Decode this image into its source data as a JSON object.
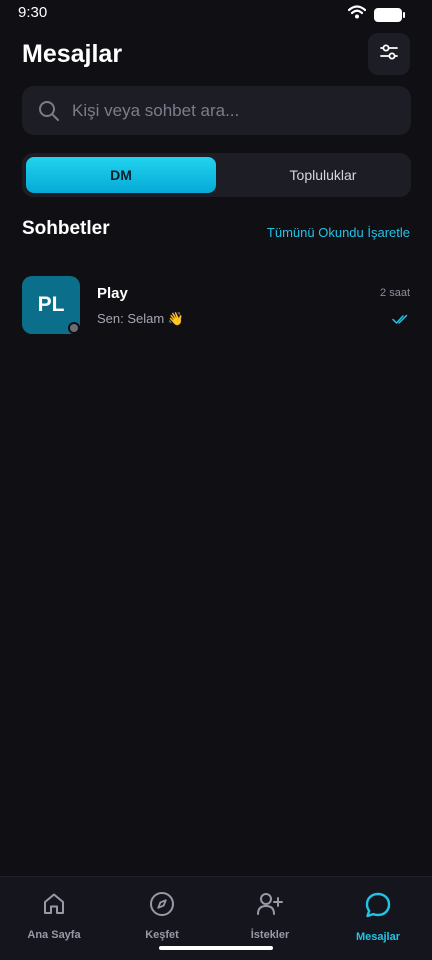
{
  "status_bar": {
    "time": "9:30"
  },
  "header": {
    "title": "Mesajlar"
  },
  "search": {
    "placeholder": "Kişi veya sohbet ara..."
  },
  "tabs": [
    {
      "label": "DM",
      "active": true
    },
    {
      "label": "Topluluklar",
      "active": false
    }
  ],
  "section": {
    "title": "Sohbetler",
    "mark_all_read": "Tümünü Okundu İşaretle"
  },
  "chats": [
    {
      "initials": "PL",
      "name": "Play",
      "preview": "Sen: Selam 👋",
      "time": "2 saat",
      "avatar_color": "#0b6f8c",
      "status": "read"
    }
  ],
  "bottom_nav": [
    {
      "label": "Ana Sayfa",
      "icon": "home-icon",
      "active": false
    },
    {
      "label": "Keşfet",
      "icon": "compass-icon",
      "active": false
    },
    {
      "label": "İstekler",
      "icon": "add-user-icon",
      "active": false
    },
    {
      "label": "Mesajlar",
      "icon": "chat-bubble-icon",
      "active": true
    }
  ],
  "colors": {
    "accent": "#22c3e6",
    "background": "#0f0f14",
    "surface": "#1c1d25"
  }
}
